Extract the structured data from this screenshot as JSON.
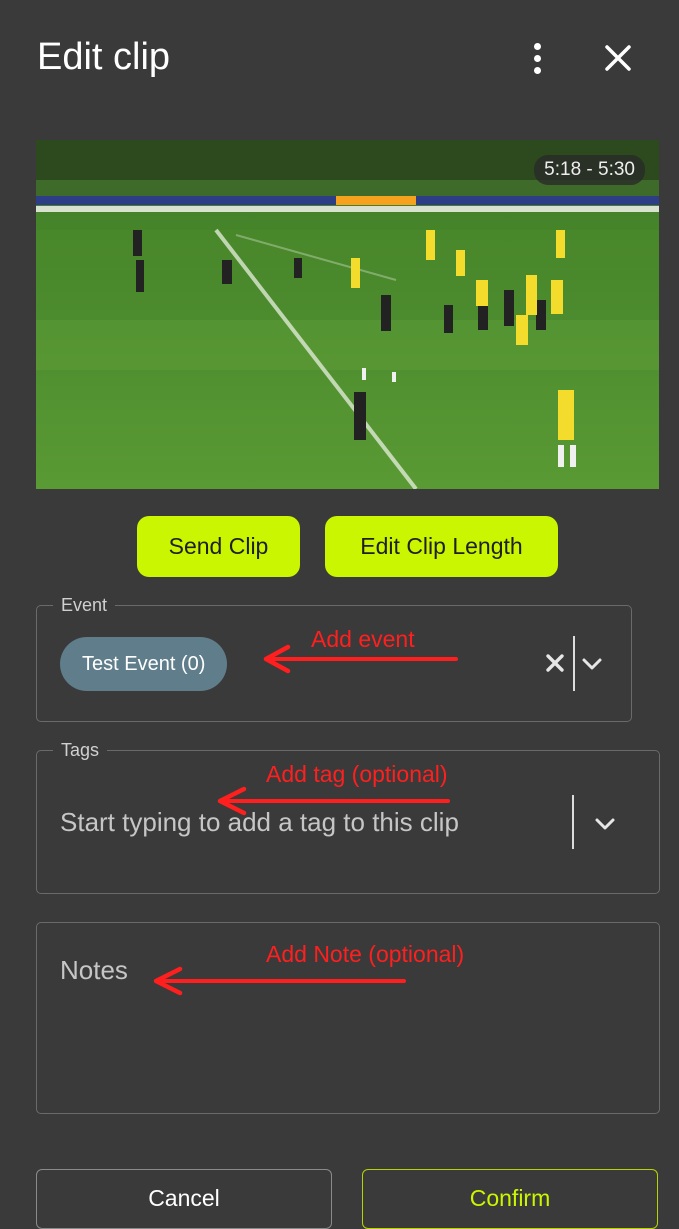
{
  "header": {
    "title": "Edit clip",
    "menu_icon": "more-vert-icon",
    "close_icon": "close-icon"
  },
  "video": {
    "time_range": "5:18 - 5:30"
  },
  "actions": {
    "send_clip": "Send Clip",
    "edit_clip_length": "Edit Clip Length"
  },
  "event_field": {
    "legend": "Event",
    "chip": "Test Event (0)"
  },
  "tags_field": {
    "legend": "Tags",
    "placeholder": "Start typing to add a tag to this clip"
  },
  "notes_field": {
    "placeholder": "Notes"
  },
  "annotations": {
    "event": "Add event",
    "tag": "Add tag (optional)",
    "note": "Add Note (optional)"
  },
  "footer": {
    "cancel": "Cancel",
    "confirm": "Confirm"
  },
  "colors": {
    "background": "#3a3a3a",
    "accent": "#c9f600",
    "chip": "#607d8b",
    "annotation": "#ff1f1f"
  }
}
